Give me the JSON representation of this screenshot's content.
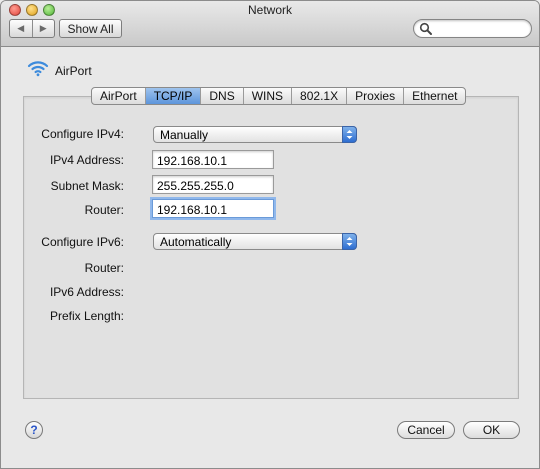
{
  "window": {
    "title": "Network"
  },
  "toolbar": {
    "back_glyph": "◀",
    "forward_glyph": "▶",
    "show_all_label": "Show All",
    "search_value": "",
    "search_placeholder": ""
  },
  "interface": {
    "name": "AirPort",
    "icon": "wifi-icon"
  },
  "tabs": [
    {
      "label": "AirPort",
      "active": false
    },
    {
      "label": "TCP/IP",
      "active": true
    },
    {
      "label": "DNS",
      "active": false
    },
    {
      "label": "WINS",
      "active": false
    },
    {
      "label": "802.1X",
      "active": false
    },
    {
      "label": "Proxies",
      "active": false
    },
    {
      "label": "Ethernet",
      "active": false
    }
  ],
  "ipv4": {
    "configure_label": "Configure IPv4:",
    "configure_value": "Manually",
    "address_label": "IPv4 Address:",
    "address_value": "192.168.10.1",
    "subnet_label": "Subnet Mask:",
    "subnet_value": "255.255.255.0",
    "router_label": "Router:",
    "router_value": "192.168.10.1"
  },
  "ipv6": {
    "configure_label": "Configure IPv6:",
    "configure_value": "Automatically",
    "router_label": "Router:",
    "address_label": "IPv6 Address:",
    "prefix_label": "Prefix Length:"
  },
  "footer": {
    "help_label": "?",
    "cancel_label": "Cancel",
    "ok_label": "OK"
  },
  "colors": {
    "accent": "#5d95db",
    "focus_ring": "#90b8ec"
  }
}
